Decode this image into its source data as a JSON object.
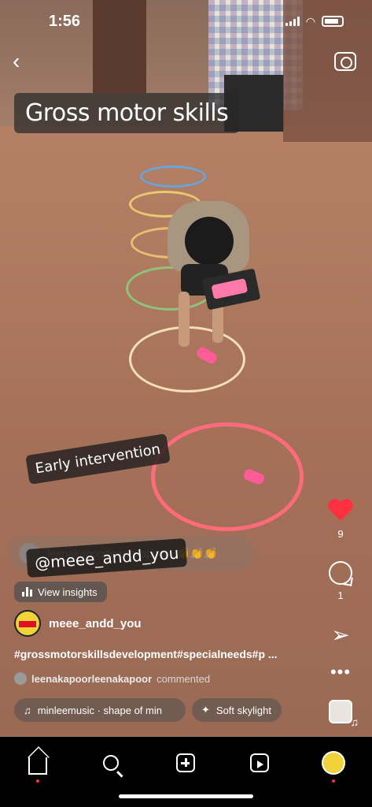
{
  "status_bar": {
    "time": "1:56"
  },
  "stickers": {
    "title": "Gross motor skills",
    "early": "Early intervention",
    "mention_faded": "leenakapoorleenakapoor",
    "mention_faded_emoji": "👏👏👏",
    "mention": "@meee_andd_you"
  },
  "insights_label": "View insights",
  "author": {
    "username": "meee_andd_you"
  },
  "caption": "#grossmotorskillsdevelopment#specialneeds#p ...",
  "commented": {
    "user": "leenakapoorleenakapoor",
    "action": "commented"
  },
  "music": {
    "text": "minleemusic · shape of min"
  },
  "effect": {
    "text": "Soft skylight"
  },
  "actions": {
    "likes": "9",
    "comments": "1"
  },
  "icons": {
    "back": "chevron-left-icon",
    "camera": "camera-icon",
    "like": "heart-icon",
    "comment": "comment-icon",
    "share": "paper-plane-icon",
    "more": "more-icon",
    "nav": [
      "home-icon",
      "search-icon",
      "add-icon",
      "reels-icon",
      "profile-icon"
    ]
  },
  "colors": {
    "like": "#ff3040",
    "notification_dot": "#ff3040"
  }
}
